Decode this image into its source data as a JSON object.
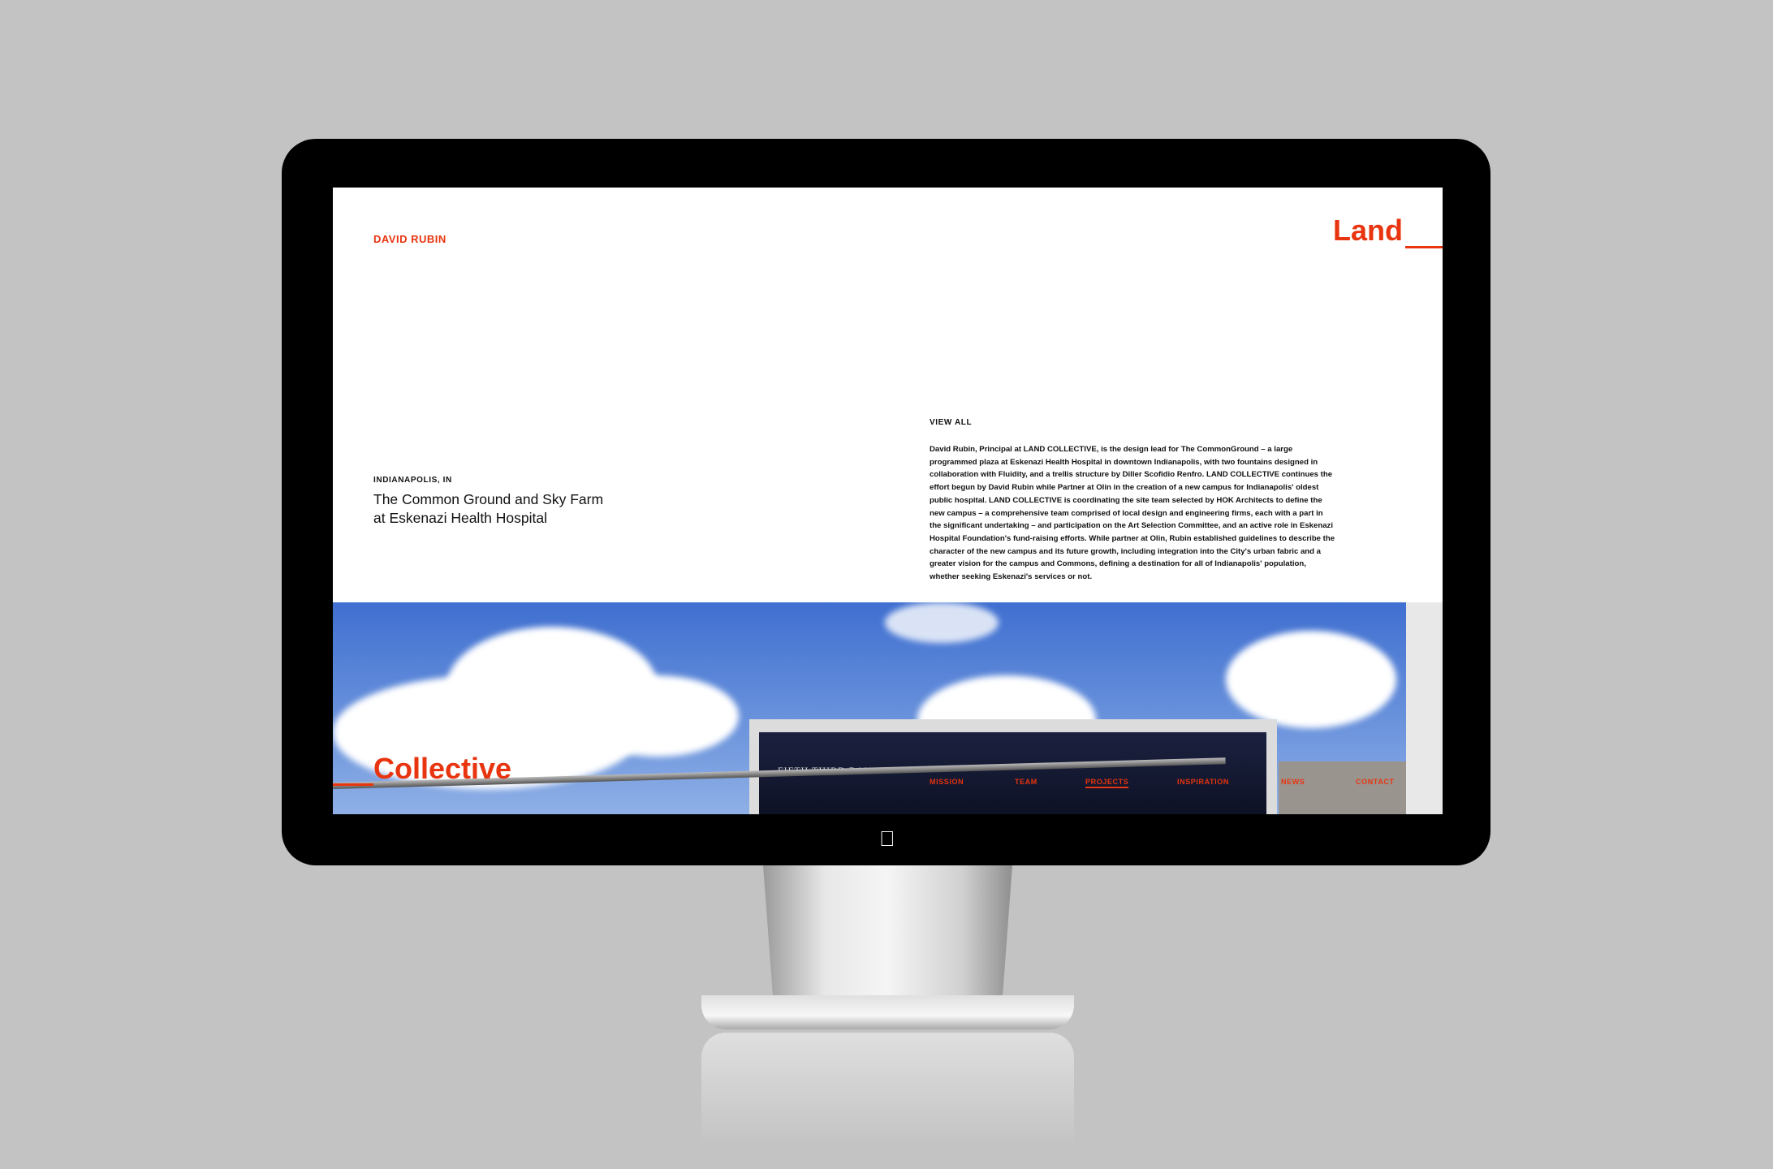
{
  "header": {
    "name": "DAVID RUBIN",
    "logo_top": "Land"
  },
  "project": {
    "location": "INDIANAPOLIS, IN",
    "title_line1": "The Common Ground and Sky Farm",
    "title_line2": "at Eskenazi Health Hospital"
  },
  "view_all": "VIEW ALL",
  "description": "David Rubin, Principal at LAND COLLECTIVE, is the design lead for The CommonGround – a large programmed plaza at Eskenazi Health Hospital in downtown Indianapolis, with two fountains designed in collaboration with Fluidity, and a trellis structure by Diller Scofidio Renfro. LAND COLLECTIVE continues the effort begun by David Rubin while Partner at Olin in the creation of a new campus for Indianapolis' oldest public hospital. LAND COLLECTIVE is coordinating the site team selected by HOK Architects to define the new campus – a comprehensive team comprised of local design and engineering firms, each with a part in the significant undertaking – and participation on the Art Selection Committee, and an active role in Eskenazi Hospital Foundation's fund-raising efforts. While partner at Olin, Rubin established guidelines to describe the character of the new campus and its future growth, including integration into the City's urban fabric and a greater vision for the campus and Commons, defining a destination for all of Indianapolis' population, whether seeking Eskenazi's services or not.",
  "logo_bottom": "Collective",
  "photo_sign": "FIFTH THIRD BANK",
  "nav": [
    {
      "label": "MISSION"
    },
    {
      "label": "TEAM"
    },
    {
      "label": "PROJECTS",
      "active": true
    },
    {
      "label": "INSPIRATION"
    },
    {
      "label": "NEWS"
    },
    {
      "label": "CONTACT"
    }
  ],
  "colors": {
    "accent": "#e8340f"
  }
}
